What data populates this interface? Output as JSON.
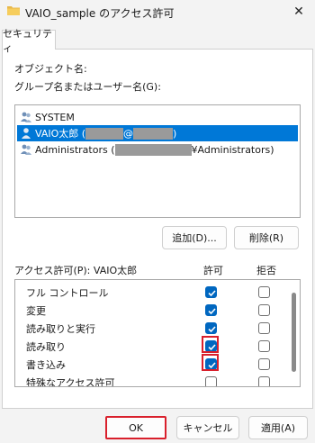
{
  "window": {
    "title": "VAIO_sample のアクセス許可",
    "close_glyph": "✕"
  },
  "tabs": [
    {
      "label": "セキュリティ",
      "active": true
    }
  ],
  "object_name_label": "オブジェクト名:",
  "principals_label": "グループ名またはユーザー名(G):",
  "principals": [
    {
      "name": "SYSTEM",
      "icon": "group-icon",
      "selected": false
    },
    {
      "name_prefix": "VAIO太郎 (",
      "redacted_mid": "@",
      "name_suffix": ")",
      "icon": "user-icon",
      "selected": true
    },
    {
      "name_prefix": "Administrators (",
      "name_suffix": "¥Administrators)",
      "icon": "group-icon",
      "selected": false
    }
  ],
  "buttons": {
    "add": "追加(D)...",
    "remove": "削除(R)"
  },
  "permissions": {
    "header_label": "アクセス許可(P): VAIO太郎",
    "allow_header": "許可",
    "deny_header": "拒否",
    "rows": [
      {
        "name": "フル コントロール",
        "allow": true,
        "deny": false
      },
      {
        "name": "変更",
        "allow": true,
        "deny": false
      },
      {
        "name": "読み取りと実行",
        "allow": true,
        "deny": false
      },
      {
        "name": "読み取り",
        "allow": true,
        "deny": false
      },
      {
        "name": "書き込み",
        "allow": true,
        "deny": false
      },
      {
        "name": "特殊なアクセス許可",
        "allow": false,
        "deny": false
      }
    ]
  },
  "footer": {
    "ok": "OK",
    "cancel": "キャンセル",
    "apply": "適用(A)"
  },
  "colors": {
    "accent": "#0078d7",
    "checkbox": "#0067c0",
    "highlight": "#d9202c"
  }
}
